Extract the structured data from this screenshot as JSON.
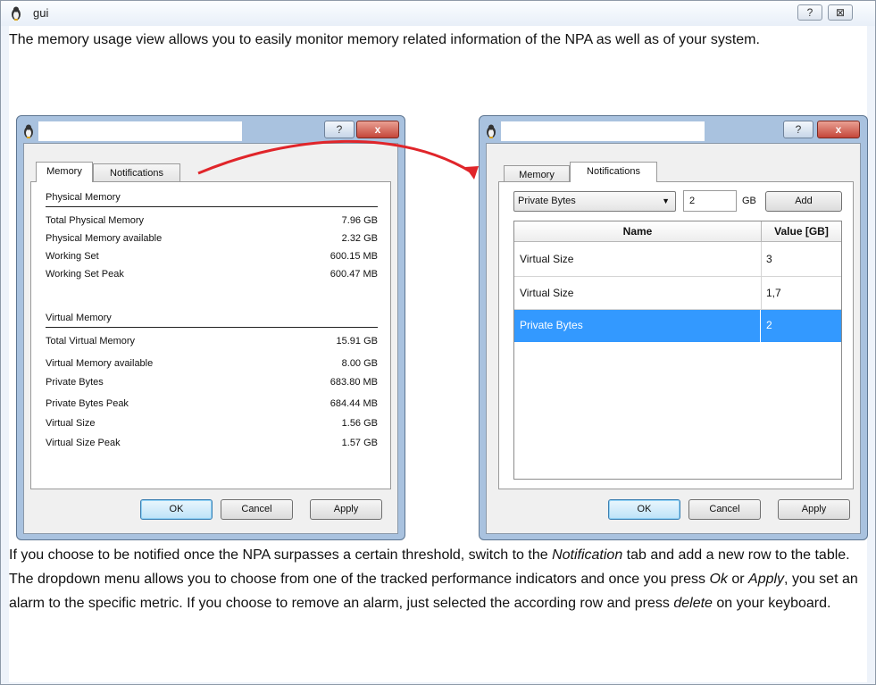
{
  "window": {
    "title": "gui",
    "help_glyph": "?",
    "close_glyph": "⊠"
  },
  "intro_text": "The memory usage view allows you to easily monitor memory related information of the NPA as well as of your system.",
  "left_dialog": {
    "help_glyph": "?",
    "close_glyph": "x",
    "tabs": [
      "Memory",
      "Notifications"
    ],
    "physical_title": "Physical Memory",
    "physical": [
      {
        "label": "Total Physical Memory",
        "value": "7.96 GB"
      },
      {
        "label": "Physical Memory available",
        "value": "2.32 GB"
      },
      {
        "label": "Working Set",
        "value": "600.15 MB"
      },
      {
        "label": "Working Set Peak",
        "value": "600.47 MB"
      }
    ],
    "virtual_title": "Virtual Memory",
    "virtual": [
      {
        "label": "Total Virtual Memory",
        "value": "15.91 GB"
      },
      {
        "label": "Virtual Memory available",
        "value": "8.00 GB"
      },
      {
        "label": "Private Bytes",
        "value": "683.80 MB"
      },
      {
        "label": "Private Bytes Peak",
        "value": "684.44 MB"
      },
      {
        "label": "Virtual Size",
        "value": "1.56 GB"
      },
      {
        "label": "Virtual Size Peak",
        "value": "1.57 GB"
      }
    ],
    "buttons": {
      "ok": "OK",
      "cancel": "Cancel",
      "apply": "Apply"
    }
  },
  "right_dialog": {
    "help_glyph": "?",
    "close_glyph": "x",
    "tabs": [
      "Memory",
      "Notifications"
    ],
    "metric_select": "Private Bytes",
    "dropdown_arrow": "▼",
    "threshold_value": "2",
    "unit": "GB",
    "add_label": "Add",
    "table": {
      "headers": [
        "Name",
        "Value [GB]"
      ],
      "rows": [
        {
          "name": "Virtual Size",
          "value": "3"
        },
        {
          "name": "Virtual Size",
          "value": "1,7"
        },
        {
          "name": "Private Bytes",
          "value": "2"
        }
      ],
      "selected_row": 2
    },
    "buttons": {
      "ok": "OK",
      "cancel": "Cancel",
      "apply": "Apply"
    }
  },
  "outro": {
    "p1": "If you choose to be notified once the NPA surpasses a certain threshold, switch to the ",
    "e1": "Notification",
    "p2": " tab and add a new row to the table. The dropdown menu allows you to choose from one of the tracked performance indicators and once you press ",
    "e2": "Ok",
    "p3": " or ",
    "e3": "Apply",
    "p4": ", you set an alarm to the specific metric. If you choose to remove an alarm, just selected the according row and press ",
    "e4": "delete",
    "p5": " on your keyboard."
  },
  "colors": {
    "selection": "#3399ff",
    "arrow": "#e0252a",
    "dialog_frame": "#a9c2df"
  }
}
